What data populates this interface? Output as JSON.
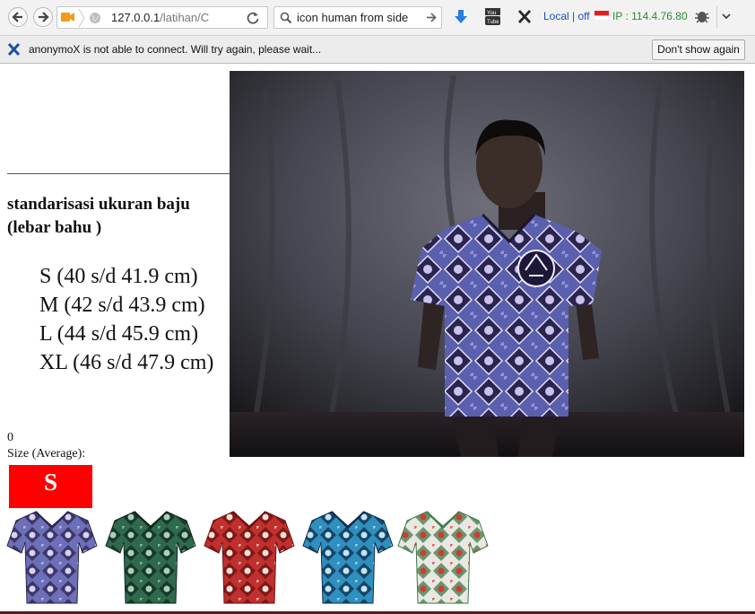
{
  "browser": {
    "url_host": "127.0.0.1",
    "url_path": "/latihan/C",
    "search_text": "icon human from side",
    "status_local": "Local | off",
    "status_ip": "IP : 114.4.76.80"
  },
  "notification": {
    "message": "anonymoX is not able to connect. Will try again, please wait...",
    "button_label": "Don't show again"
  },
  "page": {
    "heading": "standarisasi ukuran baju (lebar bahu )",
    "sizes": [
      "S (40 s/d 41.9 cm)",
      "M (42 s/d 43.9 cm)",
      "L (44 s/d 45.9 cm)",
      "XL (46 s/d 47.9 cm)"
    ],
    "counter": "0",
    "size_label": "Size (Average):",
    "size_value": "S"
  },
  "thumbnails": [
    {
      "name": "shirt-blue-batik",
      "base": "#6d6fb8",
      "accent": "#2a2550",
      "detail": "#d9d3ef"
    },
    {
      "name": "shirt-green-batik",
      "base": "#2f6a4e",
      "accent": "#10271e",
      "detail": "#a9d1b6"
    },
    {
      "name": "shirt-red-batik",
      "base": "#c0302e",
      "accent": "#6a1010",
      "detail": "#f4e3d6"
    },
    {
      "name": "shirt-turquoise-batik",
      "base": "#2f8fbf",
      "accent": "#0f2c4a",
      "detail": "#bfe6f2"
    },
    {
      "name": "shirt-white-floral",
      "base": "#e8e8e2",
      "accent": "#3e7a48",
      "detail": "#d23a34"
    }
  ],
  "colors": {
    "badge": "#ff0000",
    "toolbar": "#f2f2f2",
    "notify": "#ececec"
  }
}
